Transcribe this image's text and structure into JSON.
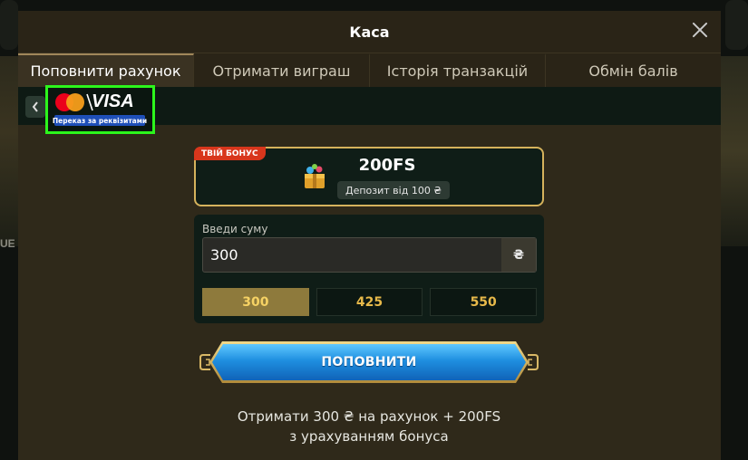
{
  "modal": {
    "title": "Каса"
  },
  "tabs": [
    {
      "label": "Поповнити рахунок",
      "active": true
    },
    {
      "label": "Отримати виграш",
      "active": false
    },
    {
      "label": "Історія транзакцій",
      "active": false
    },
    {
      "label": "Обмін балів",
      "active": false
    }
  ],
  "payment_method": {
    "brand": "VISA",
    "caption": "Переказ за реквізитами",
    "highlight_color": "#2cf51c"
  },
  "bonus": {
    "tag": "ТВІЙ БОНУС",
    "amount": "200FS",
    "deposit": "Депозит від 100 ₴"
  },
  "amount": {
    "label": "Введи суму",
    "value": "300",
    "currency": "₴",
    "presets": [
      "300",
      "425",
      "550"
    ],
    "selected": "300"
  },
  "deposit_button": {
    "label": "ПОПОВНИТИ"
  },
  "summary": {
    "line1": "Отримати 300 ₴ на рахунок + 200FS",
    "line2": "з урахуванням бонуса"
  },
  "background": {
    "partial_text": "UE"
  },
  "colors": {
    "accent_gold": "#e7b94a",
    "button_blue": "#1f8fe0",
    "bonus_tag_red": "#d8361c"
  }
}
